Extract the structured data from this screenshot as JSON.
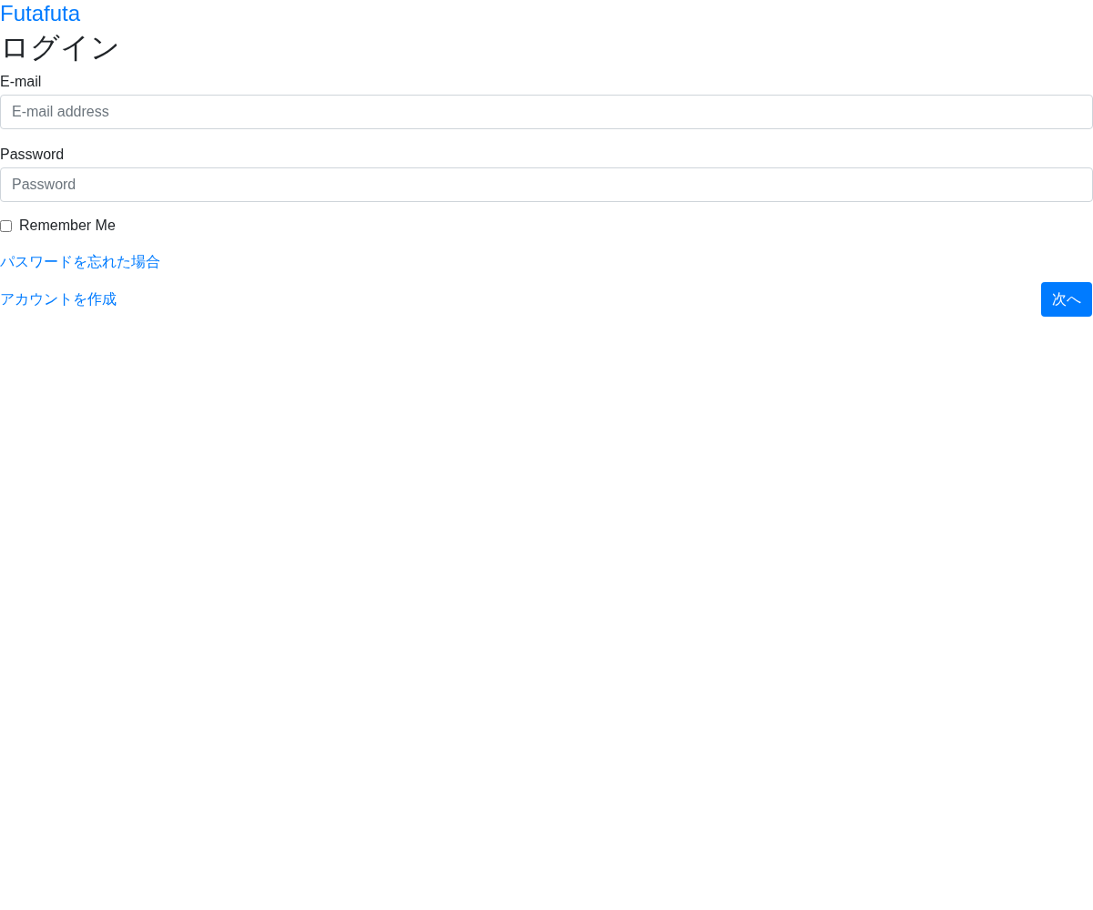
{
  "brand": "Futafuta",
  "heading": "ログイン",
  "fields": [
    {
      "label": "E-mail",
      "placeholder": "E-mail address"
    },
    {
      "label": "Password",
      "placeholder": "Password"
    }
  ],
  "remember": {
    "label": "Remember Me",
    "checked": false
  },
  "forgot_link": "パスワードを忘れた場合",
  "create_link": "アカウントを作成",
  "submit": "次へ"
}
